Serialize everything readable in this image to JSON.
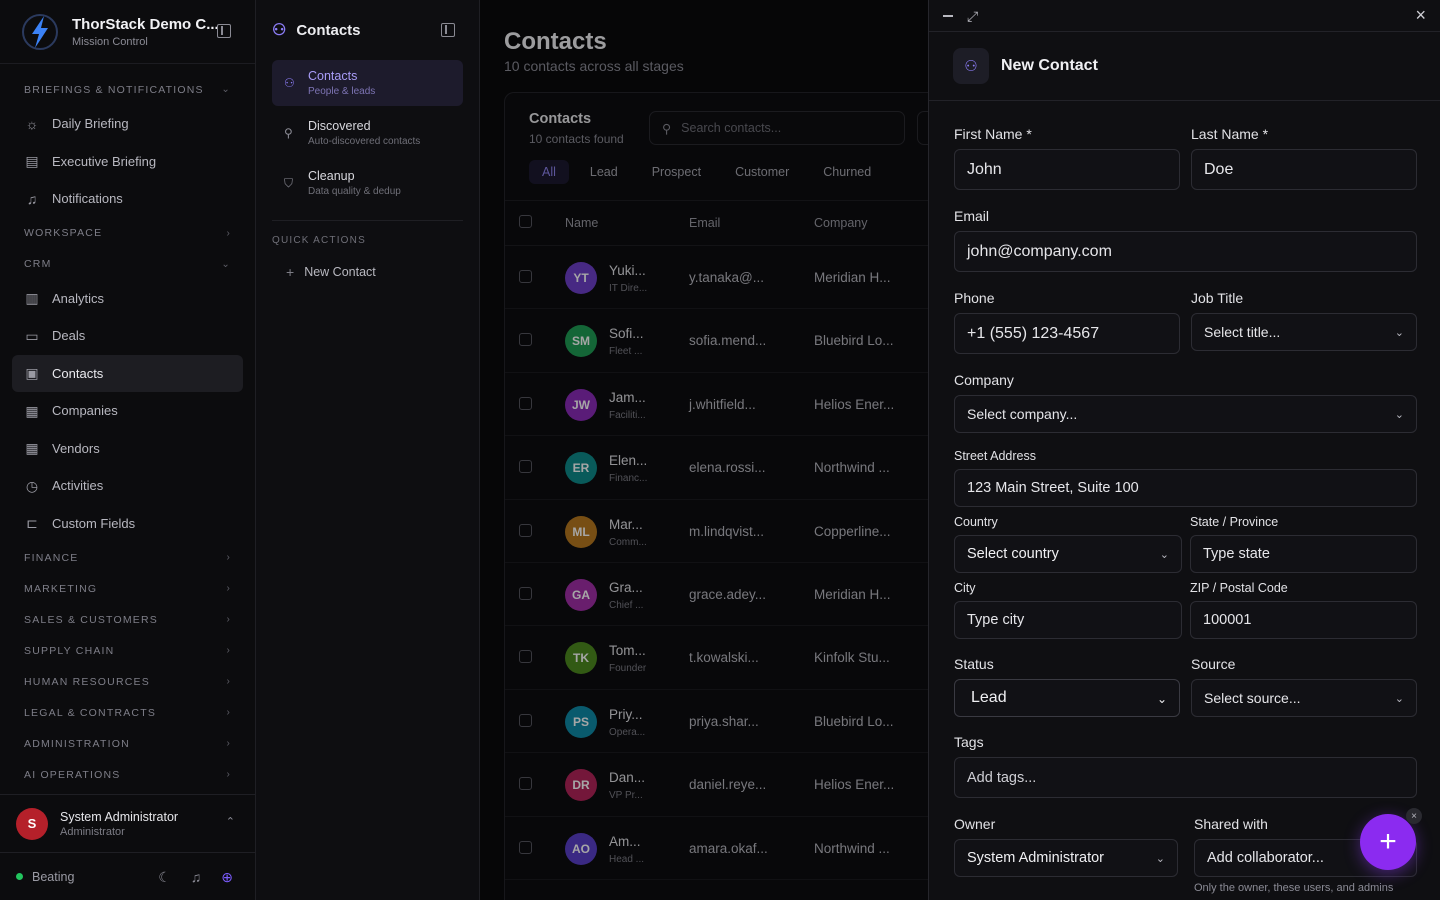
{
  "brand": {
    "title": "ThorStack Demo C...",
    "subtitle": "Mission Control"
  },
  "nav": {
    "sections": [
      {
        "label": "BRIEFINGS & NOTIFICATIONS",
        "chev": "⌄"
      },
      {
        "label": "WORKSPACE",
        "chev": "›"
      },
      {
        "label": "CRM",
        "chev": "⌄"
      },
      {
        "label": "FINANCE",
        "chev": "›"
      },
      {
        "label": "MARKETING",
        "chev": "›"
      },
      {
        "label": "SALES & CUSTOMERS",
        "chev": "›"
      },
      {
        "label": "SUPPLY CHAIN",
        "chev": "›"
      },
      {
        "label": "HUMAN RESOURCES",
        "chev": "›"
      },
      {
        "label": "LEGAL & CONTRACTS",
        "chev": "›"
      },
      {
        "label": "ADMINISTRATION",
        "chev": "›"
      },
      {
        "label": "AI OPERATIONS",
        "chev": "›"
      }
    ],
    "briefings": [
      {
        "label": "Daily Briefing",
        "icon": "☼"
      },
      {
        "label": "Executive Briefing",
        "icon": "▤"
      },
      {
        "label": "Notifications",
        "icon": "♫"
      }
    ],
    "crm": [
      {
        "label": "Analytics",
        "icon": "▥"
      },
      {
        "label": "Deals",
        "icon": "▭"
      },
      {
        "label": "Contacts",
        "icon": "▣"
      },
      {
        "label": "Companies",
        "icon": "▦"
      },
      {
        "label": "Vendors",
        "icon": "▦"
      },
      {
        "label": "Activities",
        "icon": "◷"
      },
      {
        "label": "Custom Fields",
        "icon": "⊏"
      }
    ]
  },
  "user": {
    "initial": "S",
    "name": "System Administrator",
    "role": "Administrator",
    "chev": "⌃"
  },
  "status": {
    "label": "Beating"
  },
  "sub": {
    "title": "Contacts",
    "items": [
      {
        "title": "Contacts",
        "desc": "People & leads"
      },
      {
        "title": "Discovered",
        "desc": "Auto-discovered contacts"
      },
      {
        "title": "Cleanup",
        "desc": "Data quality & dedup"
      }
    ],
    "quick_label": "QUICK ACTIONS",
    "quick_new": "New Contact"
  },
  "main": {
    "title": "Contacts",
    "subtitle": "10 contacts across all stages",
    "card_title": "Contacts",
    "card_sub": "10 contacts found",
    "search_placeholder": "Search contacts...",
    "filters": [
      "All",
      "Lead",
      "Prospect",
      "Customer",
      "Churned"
    ],
    "columns": [
      "Name",
      "Email",
      "Company"
    ],
    "rows": [
      {
        "initials": "YT",
        "color": "#6d3fc9",
        "name": "Yuki...",
        "title": "IT Dire...",
        "email": "y.tanaka@...",
        "company": "Meridian H..."
      },
      {
        "initials": "SM",
        "color": "#1f9d55",
        "name": "Sofi...",
        "title": "Fleet ...",
        "email": "sofia.mend...",
        "company": "Bluebird Lo..."
      },
      {
        "initials": "JW",
        "color": "#8a2bb8",
        "name": "Jam...",
        "title": "Faciliti...",
        "email": "j.whitfield...",
        "company": "Helios Ener..."
      },
      {
        "initials": "ER",
        "color": "#0e8a8a",
        "name": "Elen...",
        "title": "Financ...",
        "email": "elena.rossi...",
        "company": "Northwind ..."
      },
      {
        "initials": "ML",
        "color": "#b7791f",
        "name": "Mar...",
        "title": "Comm...",
        "email": "m.lindqvist...",
        "company": "Copperline..."
      },
      {
        "initials": "GA",
        "color": "#a12fa8",
        "name": "Gra...",
        "title": "Chief ...",
        "email": "grace.adey...",
        "company": "Meridian H..."
      },
      {
        "initials": "TK",
        "color": "#4d8a1f",
        "name": "Tom...",
        "title": "Founder",
        "email": "t.kowalski...",
        "company": "Kinfolk Stu..."
      },
      {
        "initials": "PS",
        "color": "#0f8aa8",
        "name": "Priy...",
        "title": "Opera...",
        "email": "priya.shar...",
        "company": "Bluebird Lo..."
      },
      {
        "initials": "DR",
        "color": "#b3245a",
        "name": "Dan...",
        "title": "VP Pr...",
        "email": "daniel.reye...",
        "company": "Helios Ener..."
      },
      {
        "initials": "AO",
        "color": "#5a3fc9",
        "name": "Am...",
        "title": "Head ...",
        "email": "amara.okaf...",
        "company": "Northwind ..."
      }
    ]
  },
  "drawer": {
    "title": "New Contact",
    "first_name_label": "First Name *",
    "first_name_ph": "John",
    "last_name_label": "Last Name *",
    "last_name_ph": "Doe",
    "email_label": "Email",
    "email_ph": "john@company.com",
    "phone_label": "Phone",
    "phone_ph": "+1 (555) 123-4567",
    "job_label": "Job Title",
    "job_ph": "Select title...",
    "company_label": "Company",
    "company_ph": "Select company...",
    "street_label": "Street Address",
    "street_ph": "123 Main Street, Suite 100",
    "country_label": "Country",
    "country_value": "Select country",
    "state_label": "State / Province",
    "state_ph": "Type state",
    "city_label": "City",
    "city_ph": "Type city",
    "zip_label": "ZIP / Postal Code",
    "zip_ph": "100001",
    "status_label": "Status",
    "status_value": "Lead",
    "source_label": "Source",
    "source_ph": "Select source...",
    "tags_label": "Tags",
    "tags_ph": "Add tags...",
    "owner_label": "Owner",
    "owner_value": "System Administrator",
    "shared_label": "Shared with",
    "shared_ph": "Add collaborator...",
    "shared_help": "Only the owner, these users, and admins"
  },
  "icons": {
    "logo": "lightning-icon",
    "contacts": "users-icon",
    "fab": "plus-icon"
  }
}
